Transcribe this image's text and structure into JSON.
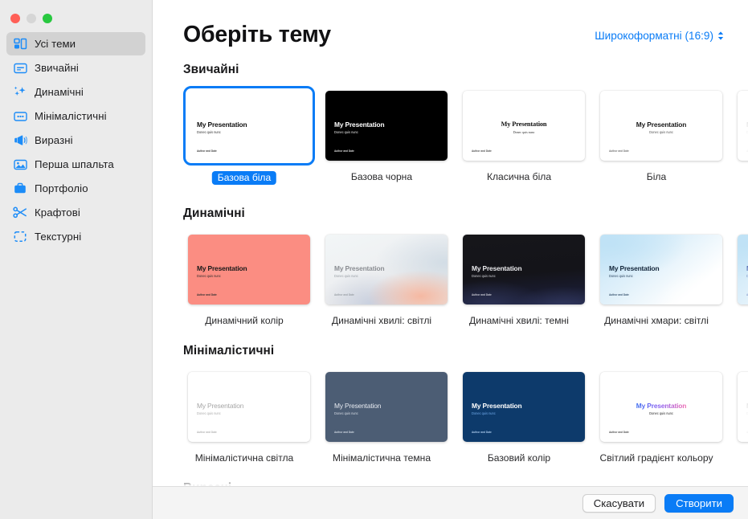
{
  "window": {
    "traffic_lights": [
      "close",
      "minimize",
      "zoom"
    ]
  },
  "sidebar": {
    "items": [
      {
        "label": "Усі теми",
        "icon": "grid-icon",
        "selected": true
      },
      {
        "label": "Звичайні",
        "icon": "rectangle-icon",
        "selected": false
      },
      {
        "label": "Динамічні",
        "icon": "sparkles-icon",
        "selected": false
      },
      {
        "label": "Мінімалістичні",
        "icon": "dots-rectangle-icon",
        "selected": false
      },
      {
        "label": "Виразні",
        "icon": "megaphone-icon",
        "selected": false
      },
      {
        "label": "Перша шпальта",
        "icon": "photo-icon",
        "selected": false
      },
      {
        "label": "Портфоліо",
        "icon": "briefcase-icon",
        "selected": false
      },
      {
        "label": "Крафтові",
        "icon": "scissors-icon",
        "selected": false
      },
      {
        "label": "Текстурні",
        "icon": "dashed-frame-icon",
        "selected": false
      }
    ]
  },
  "header": {
    "title": "Оберіть тему",
    "format_label": "Широкоформатні (16:9)"
  },
  "slide_preview": {
    "title": "My Presentation",
    "subtitle": "Donec quis nunc",
    "footer": "Author and Date"
  },
  "sections": [
    {
      "title": "Звичайні",
      "themes": [
        {
          "name": "Базова біла",
          "selected": true,
          "style": "t-white",
          "title_color": "#111111",
          "sub_color": "#333333",
          "foot_color": "#444444",
          "align": "left"
        },
        {
          "name": "Базова чорна",
          "selected": false,
          "style": "t-black",
          "title_color": "#ffffff",
          "sub_color": "#e6e6e6",
          "foot_color": "#dddddd",
          "align": "left"
        },
        {
          "name": "Класична біла",
          "selected": false,
          "style": "t-white",
          "title_color": "#121212",
          "sub_color": "#333333",
          "foot_color": "#555555",
          "align": "center",
          "serif": true
        },
        {
          "name": "Біла",
          "selected": false,
          "style": "t-white",
          "title_color": "#1a1a1a",
          "sub_color": "#555555",
          "foot_color": "#777777",
          "align": "center"
        }
      ]
    },
    {
      "title": "Динамічні",
      "themes": [
        {
          "name": "Динамічний колір",
          "selected": false,
          "style": "t-coral",
          "title_color": "#181818",
          "sub_color": "#2c2c2c",
          "foot_color": "#333333",
          "align": "left"
        },
        {
          "name": "Динамічні хвилі: світлі",
          "selected": false,
          "style": "t-wave-light",
          "title_color": "#8a8d92",
          "sub_color": "#9aa0a6",
          "foot_color": "#9aa0a6",
          "align": "left"
        },
        {
          "name": "Динамічні хвилі: темні",
          "selected": false,
          "style": "t-wave-dark",
          "title_color": "#e9e9ec",
          "sub_color": "#cfd0d6",
          "foot_color": "#c8c9d2",
          "align": "left"
        },
        {
          "name": "Динамічні хмари: світлі",
          "selected": false,
          "style": "t-cloud-light",
          "title_color": "#13263b",
          "sub_color": "#2b4560",
          "foot_color": "#3d5873",
          "align": "left"
        }
      ]
    },
    {
      "title": "Мінімалістичні",
      "themes": [
        {
          "name": "Мінімалістична світла",
          "selected": false,
          "style": "t-minlight",
          "title_color": "#a6a6a6",
          "sub_color": "#adadad",
          "foot_color": "#b4b4b4",
          "align": "left",
          "light_weight": true
        },
        {
          "name": "Мінімалістична темна",
          "selected": false,
          "style": "t-mindark",
          "title_color": "#e6eaf0",
          "sub_color": "#d4dae3",
          "foot_color": "#cbd3de",
          "align": "left",
          "light_weight": true
        },
        {
          "name": "Базовий колір",
          "selected": false,
          "style": "t-navy",
          "title_color": "#ffffff",
          "sub_color": "#6fa8e8",
          "foot_color": "#a9c8ea",
          "align": "left"
        },
        {
          "name": "Світлий градієнт кольору",
          "selected": false,
          "style": "t-gradtext",
          "title_color": "gradient",
          "sub_color": "#2b2b2b",
          "foot_color": "#555555",
          "align": "center"
        }
      ]
    },
    {
      "title": "Виразні",
      "themes": [],
      "clipped": true
    }
  ],
  "footer": {
    "cancel_label": "Скасувати",
    "create_label": "Створити"
  },
  "colors": {
    "accent": "#0a7cf6",
    "sidebar_bg": "#ebebeb",
    "sidebar_selected": "#d2d2d2",
    "footer_bg": "#f4f4f4"
  }
}
